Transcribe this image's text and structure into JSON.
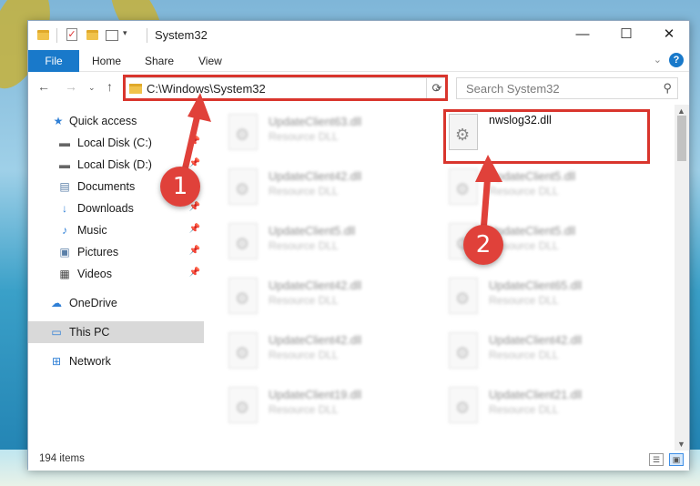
{
  "window": {
    "title": "System32"
  },
  "window_controls": {
    "minimize": "—",
    "maximize": "☐",
    "close": "✕"
  },
  "ribbon": {
    "file": "File",
    "home": "Home",
    "share": "Share",
    "view": "View",
    "help": "?"
  },
  "address": {
    "path": "C:\\Windows\\System32"
  },
  "search": {
    "placeholder": "Search System32"
  },
  "sidebar": {
    "items": [
      {
        "label": "Quick access",
        "icon": "star-icon",
        "pinned": false
      },
      {
        "label": "Local Disk (C:)",
        "icon": "drive-icon",
        "pinned": true
      },
      {
        "label": "Local Disk (D:)",
        "icon": "drive-icon",
        "pinned": true
      },
      {
        "label": "Documents",
        "icon": "documents-icon",
        "pinned": true
      },
      {
        "label": "Downloads",
        "icon": "download-icon",
        "pinned": true
      },
      {
        "label": "Music",
        "icon": "music-icon",
        "pinned": true
      },
      {
        "label": "Pictures",
        "icon": "pictures-icon",
        "pinned": true
      },
      {
        "label": "Videos",
        "icon": "videos-icon",
        "pinned": true
      },
      {
        "label": "OneDrive",
        "icon": "cloud-icon",
        "pinned": false
      },
      {
        "label": "This PC",
        "icon": "computer-icon",
        "pinned": false,
        "selected": true
      },
      {
        "label": "Network",
        "icon": "network-icon",
        "pinned": false
      }
    ]
  },
  "files": {
    "col1": [
      {
        "name": "UpdateClient63.dll",
        "type": "Resource DLL"
      },
      {
        "name": "UpdateClient42.dll",
        "type": "Resource DLL"
      },
      {
        "name": "UpdateClient5.dll",
        "type": "Resource DLL"
      },
      {
        "name": "UpdateClient42.dll",
        "type": "Resource DLL"
      },
      {
        "name": "UpdateClient42.dll",
        "type": "Resource DLL"
      },
      {
        "name": "UpdateClient19.dll",
        "type": "Resource DLL"
      }
    ],
    "col2": [
      {
        "name": "nwslog32.dll",
        "type": "",
        "highlighted": true
      },
      {
        "name": "UpdateClient5.dll",
        "type": "Resource DLL"
      },
      {
        "name": "UpdateClient5.dll",
        "type": "Resource DLL"
      },
      {
        "name": "UpdateClient65.dll",
        "type": "Resource DLL"
      },
      {
        "name": "UpdateClient42.dll",
        "type": "Resource DLL"
      },
      {
        "name": "UpdateClient21.dll",
        "type": "Resource DLL"
      }
    ]
  },
  "status": {
    "items": "194 items"
  },
  "annotations": {
    "step1": "1",
    "step2": "2",
    "color": "#e0413a",
    "highlight_color": "#d9352d"
  }
}
